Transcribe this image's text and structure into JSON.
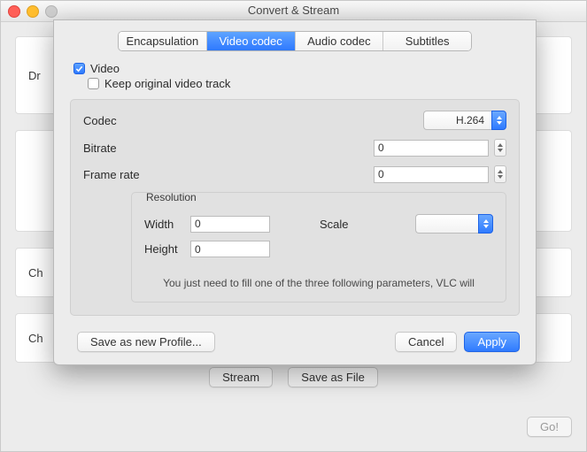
{
  "window": {
    "title": "Convert & Stream",
    "bg_panel_labels": [
      "Dr",
      "Ch",
      "Ch"
    ],
    "buttons": {
      "stream": "Stream",
      "save_as_file": "Save as File",
      "go": "Go!"
    }
  },
  "sheet": {
    "tabs": {
      "encapsulation": "Encapsulation",
      "video_codec": "Video codec",
      "audio_codec": "Audio codec",
      "subtitles": "Subtitles",
      "selected": "video_codec"
    },
    "video_checkbox_label": "Video",
    "video_checked": true,
    "keep_original_label": "Keep original video track",
    "keep_original_checked": false,
    "codec": {
      "label": "Codec",
      "value": "H.264"
    },
    "bitrate": {
      "label": "Bitrate",
      "value": "0"
    },
    "frame_rate": {
      "label": "Frame rate",
      "value": "0"
    },
    "resolution": {
      "title": "Resolution",
      "width_label": "Width",
      "width_value": "0",
      "height_label": "Height",
      "height_value": "0",
      "scale_label": "Scale",
      "scale_value": "",
      "hint": "You just need to fill one of the three following parameters, VLC will"
    },
    "buttons": {
      "save_profile": "Save as new Profile...",
      "cancel": "Cancel",
      "apply": "Apply"
    }
  }
}
